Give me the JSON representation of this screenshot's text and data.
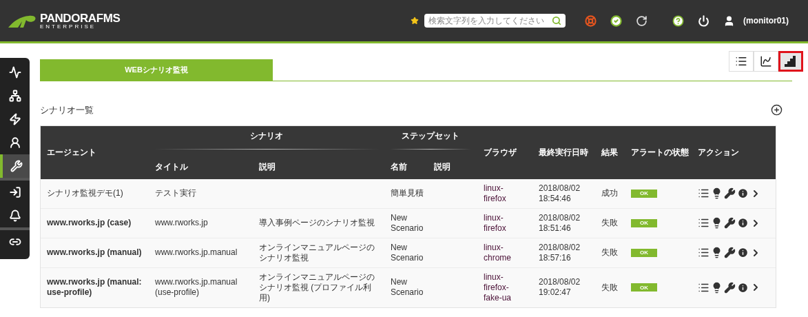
{
  "header": {
    "logo": "PANDORAFMS",
    "logo_sub": "ENTERPRISE",
    "search": {
      "placeholder": "検索文字列を入力してください"
    },
    "user": "(monitor01)"
  },
  "sidebar": {
    "items": [
      {
        "kind": "activity",
        "selected": false
      },
      {
        "kind": "network",
        "selected": false
      },
      {
        "kind": "zap",
        "selected": false
      },
      {
        "kind": "user",
        "selected": false
      },
      {
        "kind": "tools",
        "selected": true
      },
      {
        "kind": "login",
        "selected": false
      },
      {
        "kind": "bell",
        "selected": false
      },
      {
        "kind": "link",
        "selected": false
      }
    ]
  },
  "tabs": [
    {
      "label": "WEBシナリオ監視",
      "selected": true
    }
  ],
  "view_buttons": [
    {
      "kind": "list",
      "selected": false,
      "highlighted": false
    },
    {
      "kind": "chart",
      "selected": false,
      "highlighted": false
    },
    {
      "kind": "steps",
      "selected": true,
      "highlighted": true
    }
  ],
  "section_title": "シナリオ一覧",
  "table": {
    "group_headers": [
      "シナリオ",
      "ステップセット"
    ],
    "columns": [
      "エージェント",
      "タイトル",
      "説明",
      "名前",
      "説明",
      "ブラウザ",
      "最終実行日時",
      "結果",
      "アラートの状態",
      "アクション"
    ],
    "rows": [
      {
        "agent": "シナリオ監視デモ(1)",
        "agent_bold": false,
        "title": "テスト実行",
        "description": "",
        "step_name": "簡単見積",
        "browser": "linux-firefox",
        "last_run": "2018/08/02 18:54:46",
        "result": "成功",
        "alert": "OK"
      },
      {
        "agent": "www.rworks.jp (case)",
        "agent_bold": true,
        "title": "www.rworks.jp",
        "description": "導入事例ページのシナリオ監視",
        "step_name": "New Scenario",
        "browser": "linux-firefox",
        "last_run": "2018/08/02 18:51:46",
        "result": "失敗",
        "alert": "OK"
      },
      {
        "agent": "www.rworks.jp (manual)",
        "agent_bold": true,
        "title": "www.rworks.jp.manual",
        "description": "オンラインマニュアルページのシナリオ監視",
        "step_name": "New Scenario",
        "browser": "linux-chrome",
        "last_run": "2018/08/02 18:57:16",
        "result": "失敗",
        "alert": "OK"
      },
      {
        "agent": "www.rworks.jp (manual: use-profile)",
        "agent_bold": true,
        "title": "www.rworks.jp.manual (use-profile)",
        "description": "オンラインマニュアルページのシナリオ監視 (プロファイル利用)",
        "step_name": "New Scenario",
        "browser": "linux-firefox-fake-ua",
        "last_run": "2018/08/02 19:02:47",
        "result": "失敗",
        "alert": "OK"
      }
    ]
  }
}
